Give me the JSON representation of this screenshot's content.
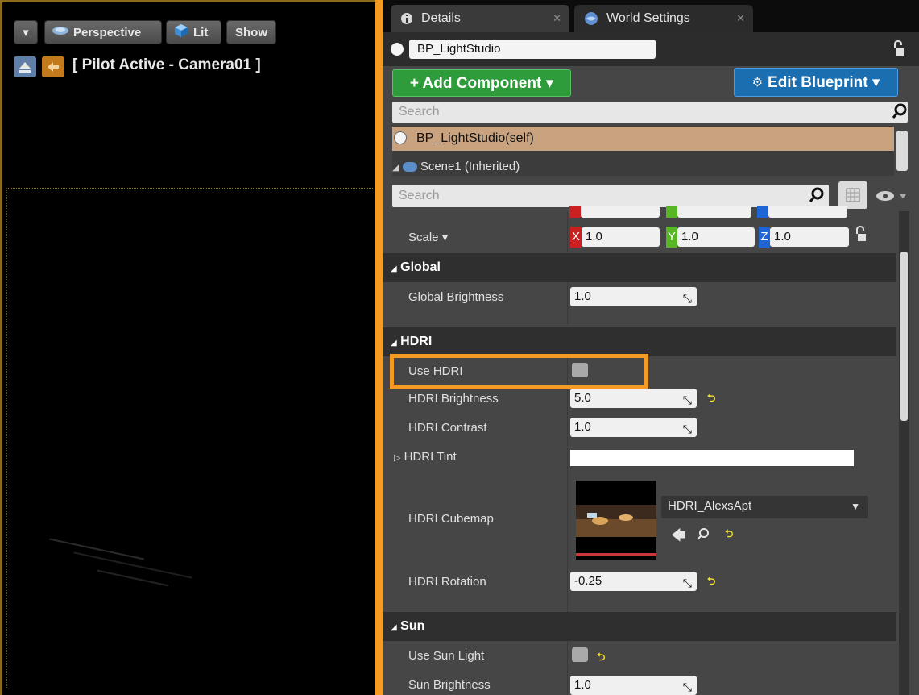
{
  "viewport": {
    "buttons": {
      "dropdown": "▾",
      "perspective": "Perspective",
      "lit": "Lit",
      "show": "Show"
    },
    "pilot_label": "[ Pilot Active - Camera01 ]"
  },
  "tabs": [
    {
      "label": "Details",
      "icon": "info-icon"
    },
    {
      "label": "World Settings",
      "icon": "globe-icon"
    }
  ],
  "actor": {
    "name": "BP_LightStudio"
  },
  "toolbar": {
    "add_component": "+ Add Component ▾",
    "edit_blueprint": "Edit Blueprint ▾"
  },
  "component_search": {
    "placeholder": "Search"
  },
  "components": {
    "self": "BP_LightStudio(self)",
    "scene": "Scene1 (Inherited)"
  },
  "details_search": {
    "placeholder": "Search"
  },
  "transform": {
    "scale_label": "Scale ▾",
    "x": "1.0",
    "y": "1.0",
    "z": "1.0"
  },
  "global": {
    "title": "Global",
    "brightness_label": "Global Brightness",
    "brightness_value": "1.0"
  },
  "hdri": {
    "title": "HDRI",
    "use_label": "Use HDRI",
    "use_checked": false,
    "brightness_label": "HDRI Brightness",
    "brightness_value": "5.0",
    "contrast_label": "HDRI Contrast",
    "contrast_value": "1.0",
    "tint_label": "HDRI Tint",
    "tint_color": "#ffffff",
    "cubemap_label": "HDRI Cubemap",
    "cubemap_asset": "HDRI_AlexsApt",
    "rotation_label": "HDRI Rotation",
    "rotation_value": "-0.25"
  },
  "sun": {
    "title": "Sun",
    "use_label": "Use Sun Light",
    "use_checked": false,
    "brightness_label": "Sun Brightness",
    "brightness_value": "1.0"
  },
  "colors": {
    "accent_orange": "#f59a23",
    "add_green": "#2e9c3a",
    "edit_blue": "#1b6fb0",
    "self_row": "#c9a27f"
  }
}
